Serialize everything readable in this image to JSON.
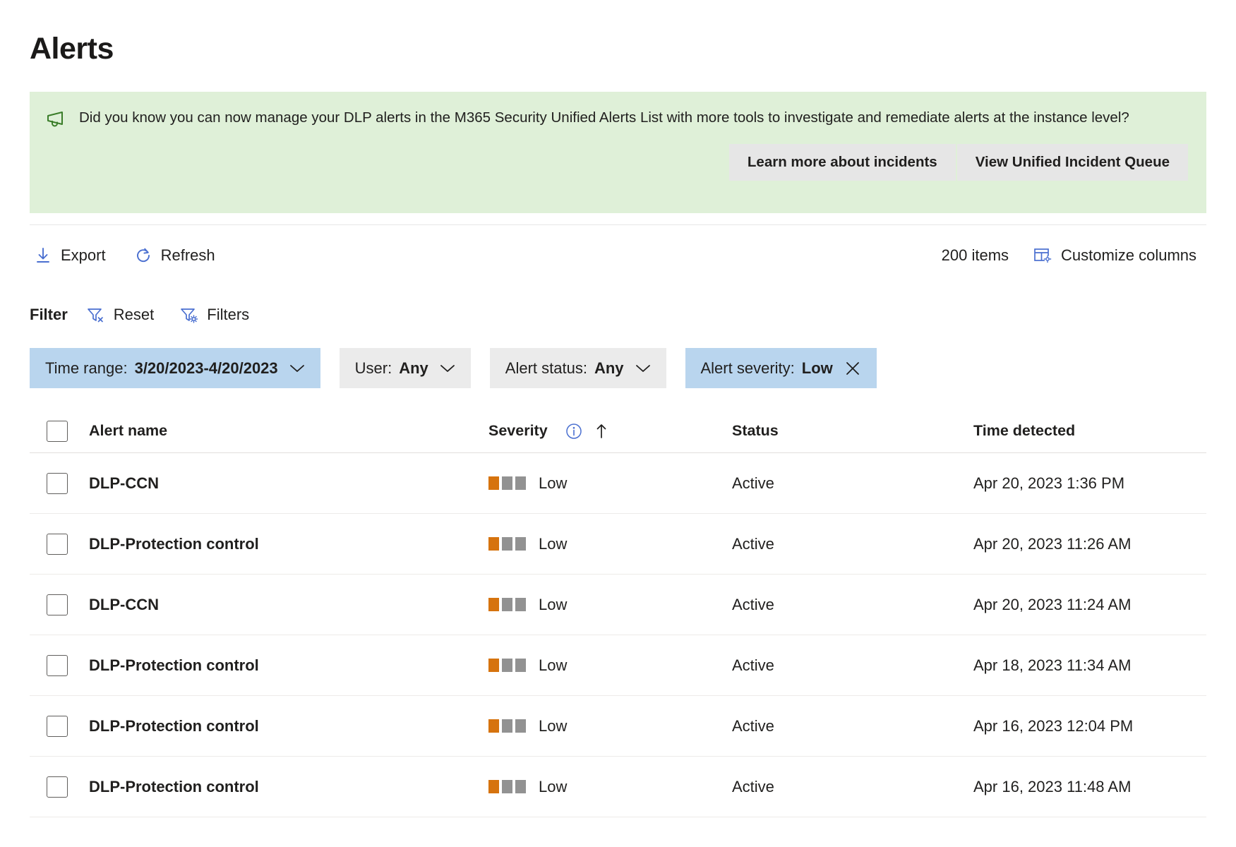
{
  "page": {
    "title": "Alerts"
  },
  "banner": {
    "icon": "megaphone-icon",
    "message": "Did you know you can now manage your DLP alerts in the M365 Security Unified Alerts List with more tools to investigate and remediate alerts at the instance level?",
    "buttons": [
      {
        "label": "Learn more about incidents",
        "name": "learn-more-about-incidents-button"
      },
      {
        "label": "View Unified Incident Queue",
        "name": "view-unified-incident-queue-button"
      }
    ],
    "background_color": "#dff0d8",
    "icon_color": "#3a7d29"
  },
  "commandbar": {
    "export_label": "Export",
    "refresh_label": "Refresh",
    "items_count": "200 items",
    "customize_columns_label": "Customize columns",
    "accent_color": "#4a6fd0"
  },
  "filterbar": {
    "label": "Filter",
    "reset_label": "Reset",
    "filters_label": "Filters"
  },
  "pills": [
    {
      "name": "time-range-filter-pill",
      "label": "Time range:",
      "value": "3/20/2023-4/20/2023",
      "glyph": "chevron-down-icon",
      "active": true
    },
    {
      "name": "user-filter-pill",
      "label": "User:",
      "value": "Any",
      "glyph": "chevron-down-icon",
      "active": false
    },
    {
      "name": "alert-status-filter-pill",
      "label": "Alert status:",
      "value": "Any",
      "glyph": "chevron-down-icon",
      "active": false
    },
    {
      "name": "alert-severity-filter-pill",
      "label": "Alert severity:",
      "value": "Low",
      "glyph": "close-icon",
      "active": true
    }
  ],
  "table": {
    "columns": {
      "alert_name": "Alert name",
      "severity": "Severity",
      "status": "Status",
      "time_detected": "Time detected"
    },
    "sort": {
      "column": "severity",
      "direction": "ascending",
      "glyph": "arrow-up-icon"
    },
    "severity_colors": {
      "filled": "#d6730e",
      "empty": "#929292"
    },
    "rows": [
      {
        "name": "DLP-CCN",
        "severity": "Low",
        "severity_level": 1,
        "status": "Active",
        "time": "Apr 20, 2023 1:36 PM"
      },
      {
        "name": "DLP-Protection control",
        "severity": "Low",
        "severity_level": 1,
        "status": "Active",
        "time": "Apr 20, 2023 11:26 AM"
      },
      {
        "name": "DLP-CCN",
        "severity": "Low",
        "severity_level": 1,
        "status": "Active",
        "time": "Apr 20, 2023 11:24 AM"
      },
      {
        "name": "DLP-Protection control",
        "severity": "Low",
        "severity_level": 1,
        "status": "Active",
        "time": "Apr 18, 2023 11:34 AM"
      },
      {
        "name": "DLP-Protection control",
        "severity": "Low",
        "severity_level": 1,
        "status": "Active",
        "time": "Apr 16, 2023 12:04 PM"
      },
      {
        "name": "DLP-Protection control",
        "severity": "Low",
        "severity_level": 1,
        "status": "Active",
        "time": "Apr 16, 2023 11:48 AM"
      }
    ]
  }
}
